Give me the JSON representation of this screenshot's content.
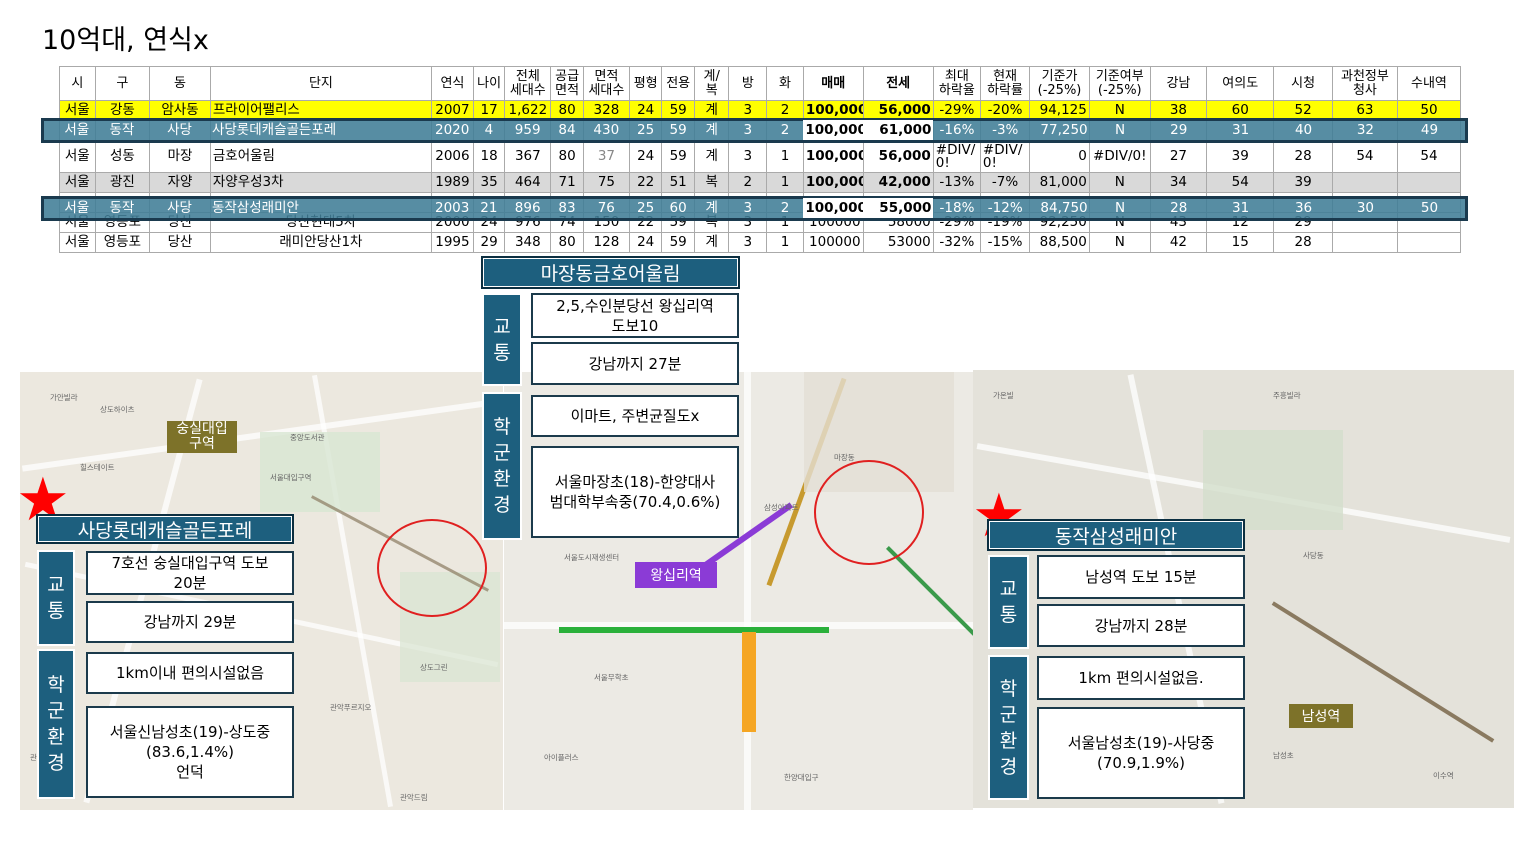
{
  "title": "10억대, 연식x",
  "table": {
    "headers": [
      "시",
      "구",
      "동",
      "단지",
      "연식",
      "나이",
      "전체\n세대수",
      "공급\n면적",
      "면적\n세대수",
      "평형",
      "전용",
      "계/\n복",
      "방",
      "화",
      "매매",
      "전세",
      "최대\n하락율",
      "현재\n하락률",
      "기준가\n(-25%)",
      "기준여부\n(-25%)",
      "강남",
      "여의도",
      "시청",
      "과천정부\n청사",
      "수내역"
    ],
    "rows": [
      [
        "서울",
        "강동",
        "암사동",
        "프라이어팰리스",
        "2007",
        "17",
        "1,622",
        "80",
        "328",
        "24",
        "59",
        "계",
        "3",
        "2",
        "100,000",
        "56,000",
        "-29%",
        "-20%",
        "94,125",
        "N",
        "38",
        "60",
        "52",
        "63",
        "50"
      ],
      [
        "서울",
        "동작",
        "사당",
        "사당롯데캐슬골든포레",
        "2020",
        "4",
        "959",
        "84",
        "430",
        "25",
        "59",
        "계",
        "3",
        "2",
        "100,000",
        "61,000",
        "-16%",
        "-3%",
        "77,250",
        "N",
        "29",
        "31",
        "40",
        "32",
        "49"
      ],
      [
        "서울",
        "성동",
        "마장",
        "금호어울림",
        "2006",
        "18",
        "367",
        "80",
        "37",
        "24",
        "59",
        "계",
        "3",
        "1",
        "100,000",
        "56,000",
        "#DIV/0!",
        "#DIV/0!",
        "0",
        "#DIV/0!",
        "27",
        "39",
        "28",
        "54",
        "54"
      ],
      [
        "서울",
        "광진",
        "자양",
        "자양우성3차",
        "1989",
        "35",
        "464",
        "71",
        "75",
        "22",
        "51",
        "복",
        "2",
        "1",
        "100,000",
        "42,000",
        "-13%",
        "-7%",
        "81,000",
        "N",
        "34",
        "54",
        "39",
        "",
        ""
      ],
      [
        "서울",
        "동작",
        "사당",
        "동작삼성래미안",
        "2003",
        "21",
        "896",
        "83",
        "76",
        "25",
        "60",
        "계",
        "3",
        "2",
        "100,000",
        "55,000",
        "-18%",
        "-12%",
        "84,750",
        "N",
        "28",
        "31",
        "36",
        "30",
        "50"
      ],
      [
        "서울",
        "영등포",
        "당산",
        "당산현대5차",
        "2000",
        "24",
        "976",
        "74",
        "150",
        "22",
        "59",
        "복",
        "3",
        "1",
        "100000",
        "58000",
        "-29%",
        "-19%",
        "92,250",
        "N",
        "43",
        "12",
        "29",
        "",
        ""
      ],
      [
        "서울",
        "영등포",
        "당산",
        "래미안당산1차",
        "1995",
        "29",
        "348",
        "80",
        "128",
        "24",
        "59",
        "계",
        "3",
        "1",
        "100000",
        "53000",
        "-32%",
        "-15%",
        "88,500",
        "N",
        "42",
        "15",
        "28",
        "",
        ""
      ]
    ]
  },
  "left": {
    "name": "사당롯데캐슬골든포레",
    "map_label": "숭실대입\n구역",
    "transport_label": "교\n통",
    "school_label": "학\n군\n환\n경",
    "items": [
      "7호선 숭실대입구역 도보\n20분",
      "강남까지 29분",
      "1km이내 편의시설없음",
      "서울신남성초(19)-상도중\n(83.6,1.4%)\n언덕"
    ]
  },
  "center": {
    "name": "마장동금호어울림",
    "station_label": "왕십리역",
    "transport_label": "교\n통",
    "school_label": "학\n군\n환\n경",
    "items": [
      "2,5,수인분당선 왕십리역\n도보10",
      "강남까지 27분",
      "이마트, 주변균질도x",
      "서울마장초(18)-한양대사\n범대학부속중(70.4,0.6%)"
    ]
  },
  "right": {
    "name": "동작삼성래미안",
    "station_label": "남성역",
    "transport_label": "교\n통",
    "school_label": "학\n군\n환\n경",
    "items": [
      "남성역 도보 15분",
      "강남까지 28분",
      "1km 편의시설없음.",
      "서울남성초(19)-사당중\n(70.9,1.9%)"
    ]
  },
  "colors": {
    "header_bg": "#1d5f7e",
    "highlight": "#ffff00",
    "row_box": "#407d96",
    "star": "#ff0000",
    "circle": "#e02020"
  }
}
